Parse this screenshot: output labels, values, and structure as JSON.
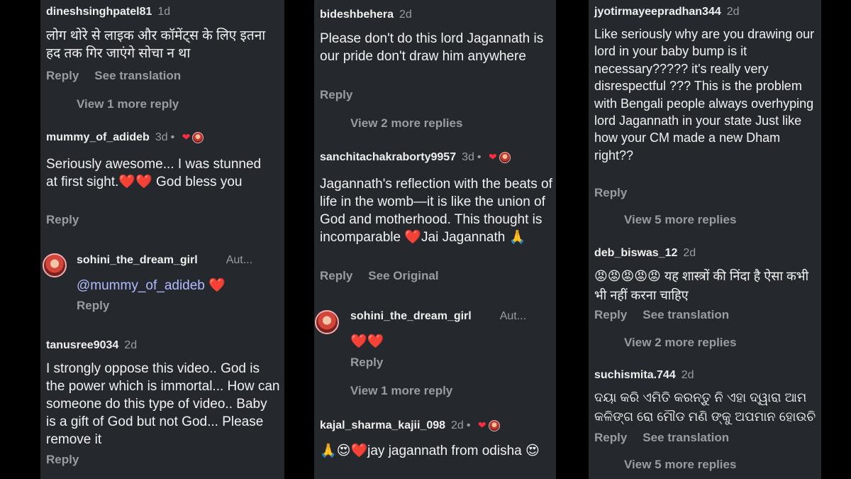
{
  "panel1": {
    "c1": {
      "user": "dineshsinghpatel81",
      "age": "1d",
      "text": "लोग थोरे से लाइक और कॉमेंट्स के लिए इतना हद तक गिर जाएंगे सोचा न था",
      "reply": "Reply",
      "translate": "See translation",
      "more": "View 1 more reply"
    },
    "c2": {
      "user": "mummy_of_adideb",
      "age": "3d",
      "dot": "•",
      "text": "Seriously awesome... I was stunned at first sight.❤️❤️ God bless you",
      "reply": "Reply"
    },
    "c2r": {
      "user": "sohini_the_dream_girl",
      "author": "Aut...",
      "mention": "@mummy_of_adideb",
      "heart": "❤️",
      "reply": "Reply"
    },
    "c3": {
      "user": "tanusree9034",
      "age": "2d",
      "text": "I strongly oppose this video.. God is the power which is immortal... How can someone do this type of video.. Baby is a gift of God but not God... Please remove it",
      "reply": "Reply"
    }
  },
  "panel2": {
    "c1": {
      "user": "bideshbehera",
      "age": "2d",
      "text": "Please don't do this lord Jagannath is our pride don't draw him anywhere",
      "reply": "Reply",
      "more": "View 2 more replies"
    },
    "c2": {
      "user": "sanchitachakraborty9957",
      "age": "3d",
      "dot": "•",
      "text": "Jagannath's reflection with the beats of life in the womb—it is like the union of God and motherhood. This thought is incomparable ❤️Jai Jagannath 🙏",
      "reply": "Reply",
      "original": "See Original"
    },
    "c2r": {
      "user": "sohini_the_dream_girl",
      "author": "Aut...",
      "text": "❤️❤️",
      "reply": "Reply",
      "more": "View 1 more reply"
    },
    "c3": {
      "user": "kajal_sharma_kajii_098",
      "age": "2d",
      "dot": "•",
      "text": "🙏😍❤️jay jagannath from odisha 😍"
    }
  },
  "panel3": {
    "c1": {
      "user": "jyotirmayeepradhan344",
      "age": "2d",
      "text": "Like seriously why are you drawing our lord in your baby bump is it necessary????? it's really very disrespectful ??? This is the problem with Bengali people always overhyping lord Jagannath in your state Just like how your CM made a new Dham right??",
      "reply": "Reply",
      "more": "View 5 more replies"
    },
    "c2": {
      "user": "deb_biswas_12",
      "age": "2d",
      "text": "😡😡😡😡😡 यह शास्त्रों की निंदा है ऐसा कभी भी नहीं करना चाहिए",
      "reply": "Reply",
      "translate": "See translation",
      "more": "View 2 more replies"
    },
    "c3": {
      "user": "suchismita.744",
      "age": "2d",
      "text": "ଦୟା କରି ଏମିତି କରନ୍ତୁ ନି ଏହା ଦ୍ୱାରା ଆମ କଳିଙ୍ଗ ରୋ ମୌଡ ମଣି ଙ୍କୁ ଅପମାନ ହୋଉଚି",
      "reply": "Reply",
      "translate": "See translation",
      "more": "View 5 more replies"
    }
  },
  "colors": {
    "panel_bg": "#25282d",
    "muted": "#9a9ca1",
    "mention": "#b2bbff",
    "heart": "#ff2d3f"
  },
  "icons": {
    "badge_heart": "heart-icon",
    "badge_avatar": "creator-avatar-icon"
  }
}
